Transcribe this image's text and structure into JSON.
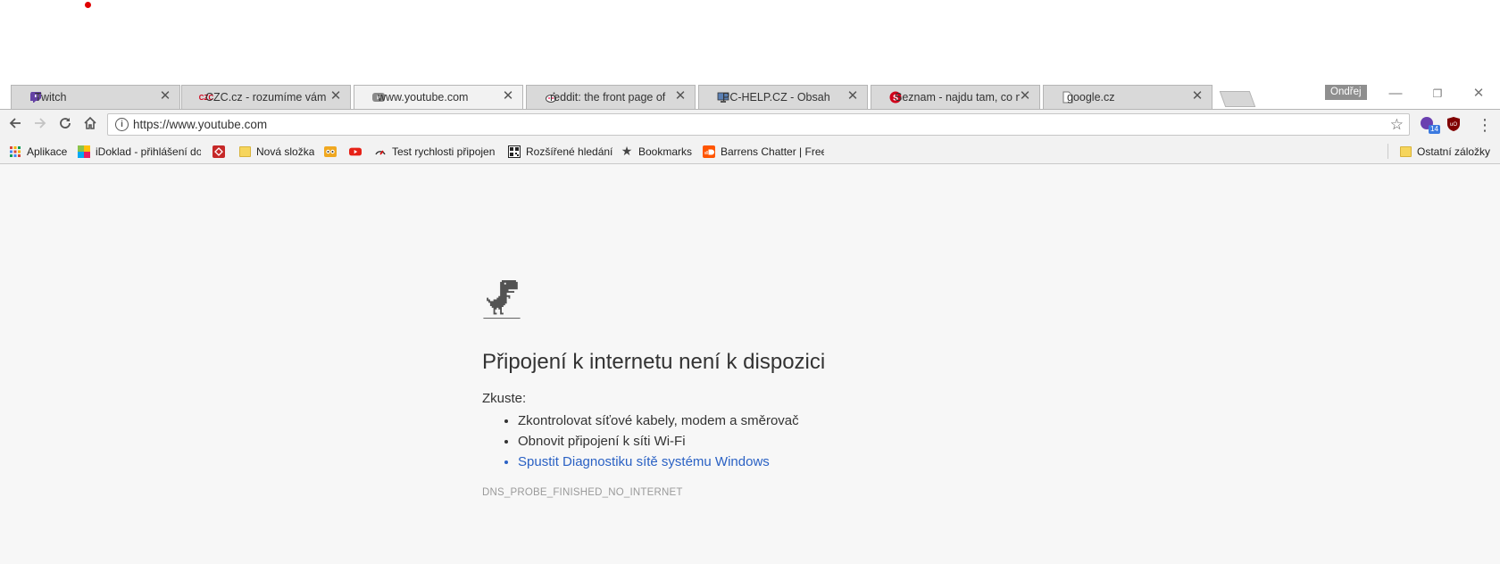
{
  "tabs": [
    {
      "title": "Twitch",
      "favicon": "twitch-icon",
      "active": false
    },
    {
      "title": "CZC.cz - rozumíme vám",
      "favicon": "czc-icon",
      "active": false
    },
    {
      "title": "www.youtube.com",
      "favicon": "youtube-icon",
      "active": true
    },
    {
      "title": "reddit: the front page of",
      "favicon": "reddit-icon",
      "active": false
    },
    {
      "title": "PC-HELP.CZ - Obsah",
      "favicon": "pc-help-icon",
      "active": false
    },
    {
      "title": "Seznam - najdu tam, co n",
      "favicon": "seznam-icon",
      "active": false
    },
    {
      "title": "google.cz",
      "favicon": "page-icon",
      "active": false
    }
  ],
  "profile_name": "Ondřej",
  "omnibox": {
    "url": "https://www.youtube.com"
  },
  "extensions": {
    "badge": "14"
  },
  "bookmarks": [
    {
      "label": "Aplikace",
      "icon": "apps-grid-icon"
    },
    {
      "label": "iDoklad - přihlášení do",
      "icon": "idoklad-icon"
    },
    {
      "label": "",
      "icon": "red-diamond-icon"
    },
    {
      "label": "Nová složka",
      "icon": "folder-icon"
    },
    {
      "label": "",
      "icon": "owl-icon"
    },
    {
      "label": "",
      "icon": "youtube-icon"
    },
    {
      "label": "Test rychlosti připojen",
      "icon": "speedtest-icon"
    },
    {
      "label": "Rozšířené hledání",
      "icon": "qr-icon"
    },
    {
      "label": "Bookmarks",
      "icon": "star-icon"
    },
    {
      "label": "Barrens Chatter | Free",
      "icon": "soundcloud-icon"
    }
  ],
  "other_bookmarks": "Ostatní záložky",
  "error": {
    "title": "Připojení k internetu není k dispozici",
    "try_label": "Zkuste:",
    "suggestions": [
      "Zkontrolovat síťové kabely, modem a směrovač",
      "Obnovit připojení k síti Wi-Fi",
      "Spustit Diagnostiku sítě systému Windows"
    ],
    "code": "DNS_PROBE_FINISHED_NO_INTERNET"
  },
  "colors": {
    "accent_link": "#2a61c4",
    "page_bg": "#f7f7f7",
    "tab_inactive": "#d9d9d9"
  }
}
